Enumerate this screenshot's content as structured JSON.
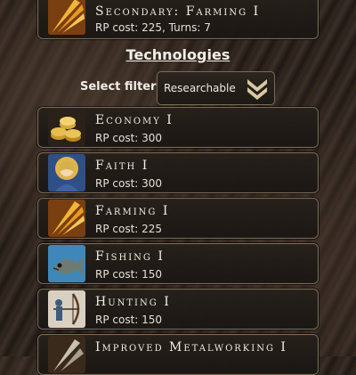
{
  "current_research": {
    "name": "Secondary: Farming I",
    "detail": "RP cost: 225, Turns: 7",
    "icon": "wheat-icon"
  },
  "section_title": "Technologies",
  "filter": {
    "label": "Select filter:",
    "value": "Researchable",
    "icon": "double-chevron-down-icon"
  },
  "technologies": [
    {
      "name": "Economy I",
      "cost": "RP cost: 300",
      "icon": "gold-coins-icon"
    },
    {
      "name": "Faith I",
      "cost": "RP cost: 300",
      "icon": "saint-icon"
    },
    {
      "name": "Farming I",
      "cost": "RP cost: 225",
      "icon": "wheat-icon"
    },
    {
      "name": "Fishing I",
      "cost": "RP cost: 150",
      "icon": "fish-icon"
    },
    {
      "name": "Hunting I",
      "cost": "RP cost: 150",
      "icon": "archer-icon"
    },
    {
      "name": "Improved Metalworking I",
      "cost": "",
      "icon": "metal-icon"
    }
  ]
}
